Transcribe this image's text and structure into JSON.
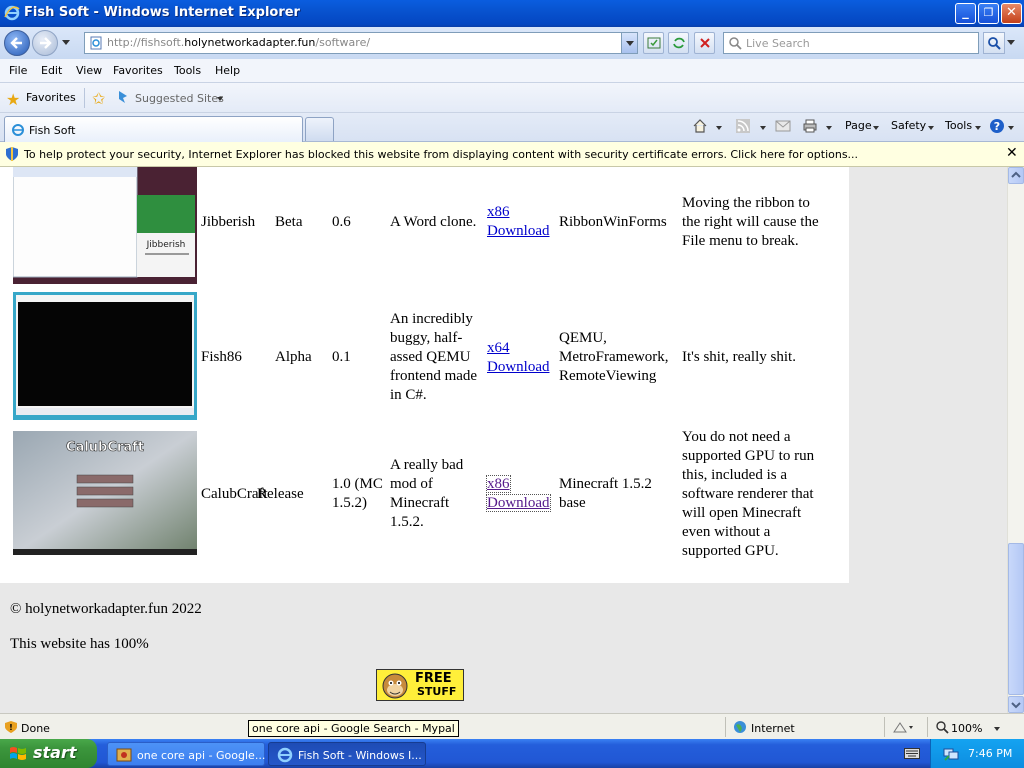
{
  "window": {
    "title": "Fish Soft - Windows Internet Explorer",
    "minimize": "_",
    "maximize": "❐",
    "close": "✕"
  },
  "address": {
    "url_prefix": "http://fishsoft.",
    "url_host": "holynetworkadapter.fun",
    "url_path": "/software/"
  },
  "search": {
    "placeholder": "Live Search"
  },
  "menu": [
    "File",
    "Edit",
    "View",
    "Favorites",
    "Tools",
    "Help"
  ],
  "favorites_bar": {
    "favorites_label": "Favorites",
    "suggested_sites": "Suggested Sites"
  },
  "tabs": [
    {
      "label": "Fish Soft"
    }
  ],
  "commandbar": {
    "page": "Page",
    "safety": "Safety",
    "tools": "Tools"
  },
  "infobar": {
    "message": "To help protect your security, Internet Explorer has blocked this website from displaying content with security certificate errors. Click here for options...",
    "close": "✕"
  },
  "software": [
    {
      "name": "Jibberish",
      "stage": "Beta",
      "version": "0.6",
      "description": "A Word clone.",
      "arch": "x86",
      "download_label": "Download",
      "libraries": "RibbonWinForms",
      "notes": "Moving the ribbon to the right will cause the File menu to break.",
      "screenshot_caption": "Jibberish"
    },
    {
      "name": "Fish86",
      "stage": "Alpha",
      "version": "0.1",
      "description": "An incredibly buggy, half-assed QEMU frontend made in C#.",
      "arch": "x64",
      "download_label": "Download",
      "libraries": "QEMU, MetroFramework, RemoteViewing",
      "notes": "It's shit, really shit."
    },
    {
      "name": "CalubCraft",
      "stage": "Release",
      "version": "1.0 (MC 1.5.2)",
      "description": "A really bad mod of Minecraft 1.5.2.",
      "arch": "x86",
      "download_label": "Download",
      "libraries": "Minecraft 1.5.2 base",
      "notes": "You do not need a supported GPU to run this, included is a software renderer that will open Minecraft even without a supported GPU.",
      "screenshot_caption": "CalubCraft"
    }
  ],
  "footer": {
    "copyright": "© holynetworkadapter.fun 2022",
    "uptime": "This website has 100%",
    "badge_line1": "FREE",
    "badge_line2": "STUFF"
  },
  "status": {
    "text": "Done",
    "zone": "Internet",
    "zoom": "100%",
    "tooltip": "one core api - Google Search - Mypal"
  },
  "taskbar": {
    "start": "start",
    "tasks": [
      {
        "label": "one core api - Google..."
      },
      {
        "label": "Fish Soft - Windows I..."
      }
    ],
    "clock": "7:46 PM"
  },
  "colors": {
    "link": "#0000cc",
    "visited_link": "#551a8b",
    "infobar_bg": "#ffffe1",
    "taskbar_blue": "#245edb",
    "start_green": "#3c963d"
  }
}
